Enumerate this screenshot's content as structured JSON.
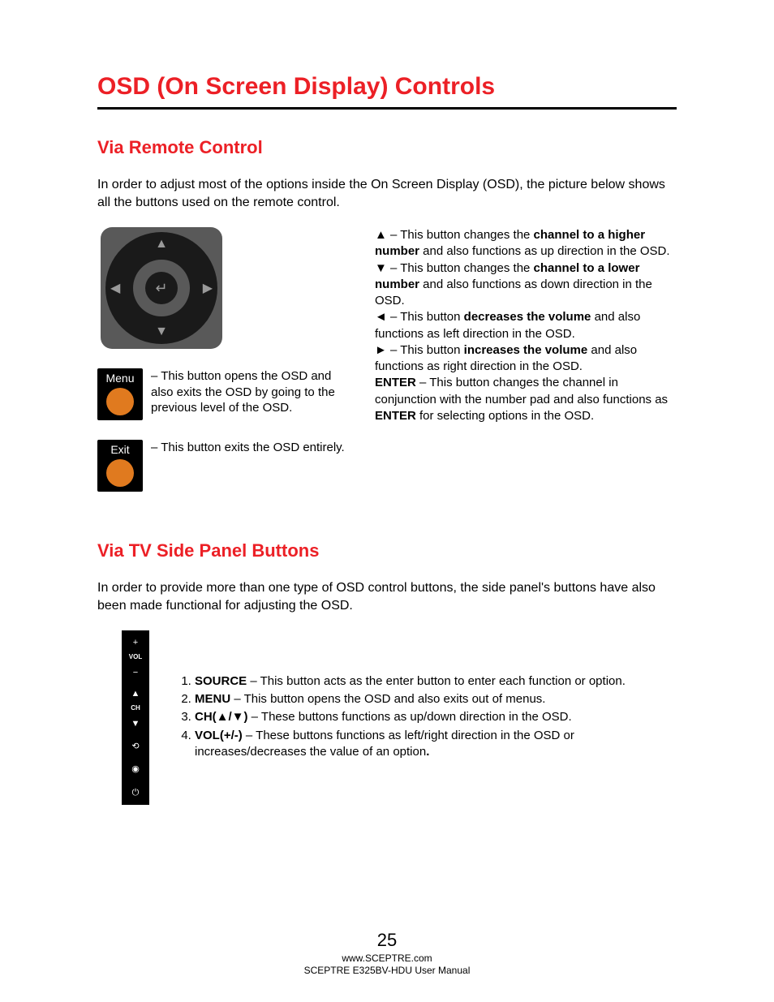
{
  "title": "OSD (On Screen Display) Controls",
  "section1": {
    "heading": "Via Remote Control",
    "intro": "In order to adjust most of the options inside the On Screen Display (OSD), the picture below shows all the buttons used on the remote control.",
    "menu_label": "Menu",
    "menu_desc": " – This button opens the OSD and also exits the OSD by going to the previous level of the OSD.",
    "exit_label": "Exit",
    "exit_desc": " – This button exits the OSD entirely.",
    "up_sym": "▲",
    "up_a": " – This button changes the ",
    "up_b": "channel to a higher number",
    "up_c": " and also functions as up direction in the OSD.",
    "down_sym": "▼",
    "down_a": " – This button changes the ",
    "down_b": "channel to a lower number",
    "down_c": " and also functions as down direction in the OSD.",
    "left_sym": "◄",
    "left_a": " – This button ",
    "left_b": "decreases the volume",
    "left_c": " and also functions as left direction in the OSD.",
    "right_sym": "►",
    "right_a": " – This button ",
    "right_b": "increases the volume",
    "right_c": " and also functions as right direction in the OSD.",
    "enter_b": "ENTER ",
    "enter_a": " – This button changes the channel in conjunction with the number pad and also functions as ",
    "enter_c": "ENTER",
    "enter_d": " for selecting options in the OSD."
  },
  "section2": {
    "heading": "Via TV Side Panel Buttons",
    "intro": "In order to provide more than one type of OSD control buttons, the side panel's buttons have also been made functional for adjusting the OSD.",
    "panel_labels": {
      "plus": "+",
      "vol": "VOL",
      "minus": "−",
      "up": "▲",
      "ch": "CH",
      "down": "▼"
    },
    "items": {
      "i1b": "SOURCE",
      "i1": " – This button acts as the enter button to enter each function or option.",
      "i2b": "MENU",
      "i2": " – This button opens the OSD and also exits out of menus.",
      "i3b": "CH(▲/▼)",
      "i3": " – These buttons functions as up/down direction in the OSD.",
      "i4b": "VOL(+/-)",
      "i4": " – These buttons functions as left/right direction in the OSD or increases/decreases the value of an option",
      "i4dot": "."
    }
  },
  "footer": {
    "page": "25",
    "url": "www.SCEPTRE.com",
    "manual": "SCEPTRE E325BV-HDU User Manual"
  }
}
